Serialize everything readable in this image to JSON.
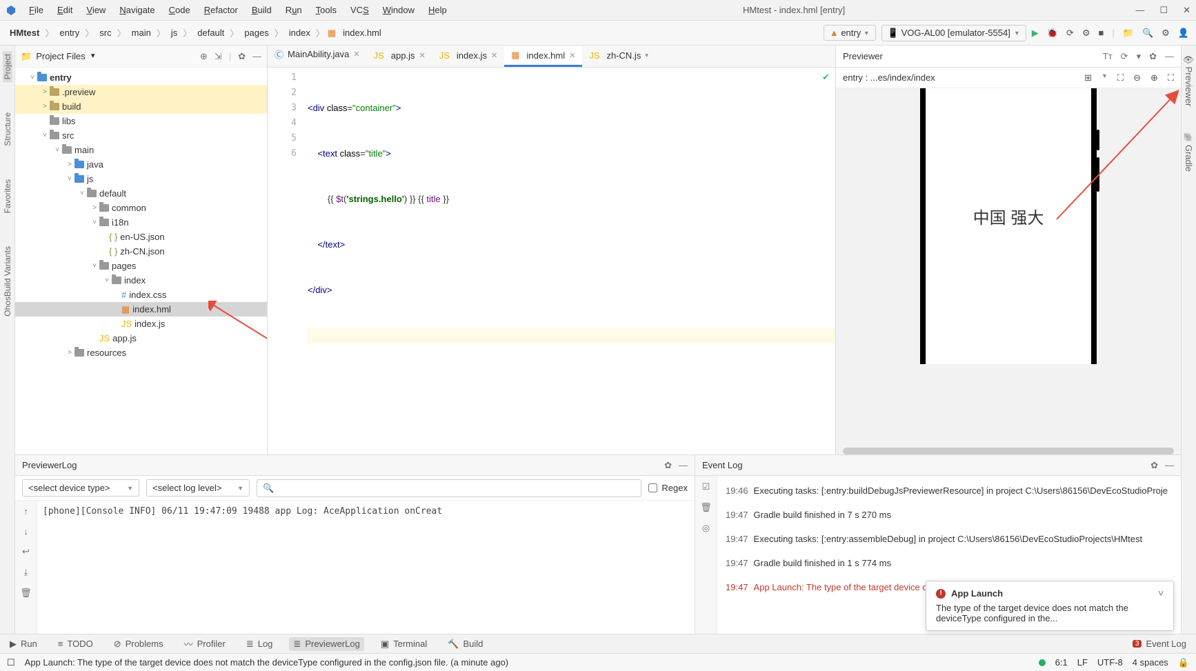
{
  "window": {
    "title": "HMtest - index.hml [entry]"
  },
  "menu": [
    "File",
    "Edit",
    "View",
    "Navigate",
    "Code",
    "Refactor",
    "Build",
    "Run",
    "Tools",
    "VCS",
    "Window",
    "Help"
  ],
  "breadcrumb": [
    "HMtest",
    "entry",
    "src",
    "main",
    "js",
    "default",
    "pages",
    "index",
    "index.hml"
  ],
  "module_selector": "entry",
  "device_selector": "VOG-AL00 [emulator-5554]",
  "project_panel": {
    "title": "Project Files"
  },
  "tree": {
    "root": "entry",
    "preview": ".preview",
    "build": "build",
    "libs": "libs",
    "src": "src",
    "main": "main",
    "java": "java",
    "js": "js",
    "default": "default",
    "common": "common",
    "i18n": "i18n",
    "en_us": "en-US.json",
    "zh_cn": "zh-CN.json",
    "pages": "pages",
    "index": "index",
    "index_css": "index.css",
    "index_hml": "index.hml",
    "index_js": "index.js",
    "app_js": "app.js",
    "resources": "resources"
  },
  "editor_tabs": [
    {
      "label": "MainAbility.java",
      "icon": "java"
    },
    {
      "label": "app.js",
      "icon": "js"
    },
    {
      "label": "index.js",
      "icon": "js"
    },
    {
      "label": "index.hml",
      "icon": "hml",
      "active": true
    },
    {
      "label": "zh-CN.js",
      "icon": "js",
      "trunc": true
    }
  ],
  "code": {
    "l1_a": "<div",
    "l1_b": " class",
    "l1_c": "=",
    "l1_d": "\"container\"",
    "l1_e": ">",
    "l2_a": "    <text",
    "l2_b": " class",
    "l2_c": "=",
    "l2_d": "\"title\"",
    "l2_e": ">",
    "l3_a": "        {{ ",
    "l3_b": "$t",
    "l3_c": "(",
    "l3_d": "'strings.hello'",
    "l3_e": ") }} {{ ",
    "l3_f": "title",
    "l3_g": " }}",
    "l4": "    </text>",
    "l5": "</div>"
  },
  "previewer": {
    "title": "Previewer",
    "path": "entry : ...es/index/index",
    "device_text": "中国 强大"
  },
  "previewer_log": {
    "title": "PreviewerLog",
    "device_ph": "<select device type>",
    "level_ph": "<select log level>",
    "regex": "Regex",
    "line": "[phone][Console    INFO]  06/11 19:47:09 19488  app Log: AceApplication onCreat"
  },
  "event_log": {
    "title": "Event Log",
    "rows": [
      {
        "t": "19:46",
        "m": "Executing tasks: [:entry:buildDebugJsPreviewerResource] in project C:\\Users\\86156\\DevEcoStudioProje"
      },
      {
        "t": "19:47",
        "m": "Gradle build finished in 7 s 270 ms"
      },
      {
        "t": "19:47",
        "m": "Executing tasks: [:entry:assembleDebug] in project C:\\Users\\86156\\DevEcoStudioProjects\\HMtest"
      },
      {
        "t": "19:47",
        "m": "Gradle build finished in 1 s 774 ms"
      },
      {
        "t": "19:47",
        "m": "App Launch: The type of the target device d",
        "err": true
      }
    ]
  },
  "popup": {
    "title": "App Launch",
    "body": "The type of the target device does not match the deviceType configured in the..."
  },
  "tool_windows": {
    "run": "Run",
    "todo": "TODO",
    "problems": "Problems",
    "profiler": "Profiler",
    "log": "Log",
    "previewer_log": "PreviewerLog",
    "terminal": "Terminal",
    "build_tw": "Build",
    "event_log": "Event Log",
    "badge": "3"
  },
  "status": {
    "msg": "App Launch: The type of the target device does not match the deviceType configured in the config.json file. (a minute ago)",
    "pos": "6:1",
    "lf": "LF",
    "enc": "UTF-8",
    "spaces": "4 spaces"
  },
  "side_left": [
    "Project",
    "Structure",
    "Favorites",
    "OhosBuild Variants"
  ],
  "side_right": [
    "Previewer",
    "Gradle"
  ]
}
